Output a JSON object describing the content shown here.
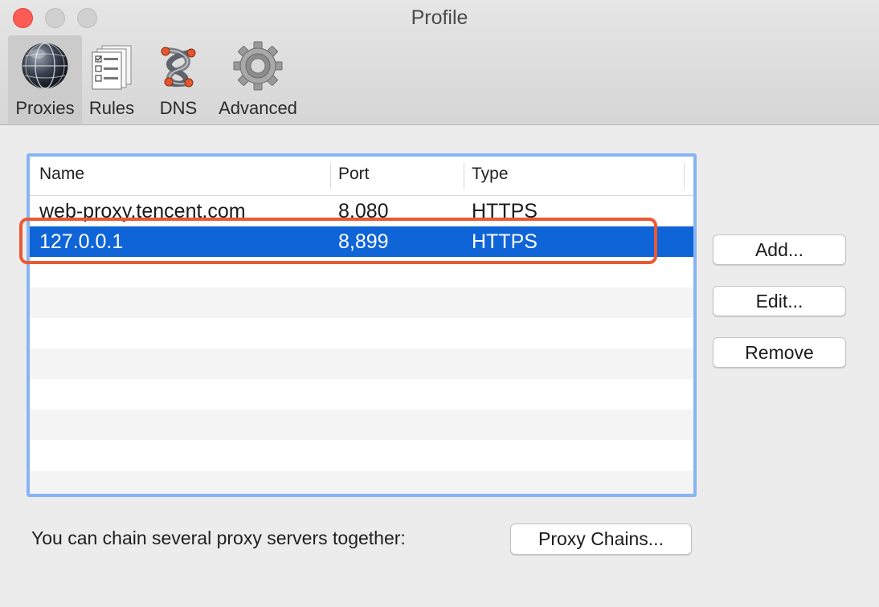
{
  "window": {
    "title": "Profile"
  },
  "toolbar": {
    "items": [
      {
        "label": "Proxies",
        "icon": "globe-icon",
        "selected": true
      },
      {
        "label": "Rules",
        "icon": "rules-list-icon"
      },
      {
        "label": "DNS",
        "icon": "dns-network-icon"
      },
      {
        "label": "Advanced",
        "icon": "gear-icon"
      }
    ]
  },
  "table": {
    "columns": [
      "Name",
      "Port",
      "Type"
    ],
    "rows": [
      {
        "name": "web-proxy.tencent.com",
        "port": "8,080",
        "type": "HTTPS"
      },
      {
        "name": "127.0.0.1",
        "port": "8,899",
        "type": "HTTPS",
        "selected": true
      }
    ]
  },
  "buttons": {
    "add": "Add...",
    "edit": "Edit...",
    "remove": "Remove"
  },
  "footer": {
    "text": "You can chain several proxy servers together:",
    "button": "Proxy Chains..."
  },
  "colors": {
    "selection": "#0f64d8",
    "focus_ring": "#88b4f4",
    "annotation_box": "#ea5a34",
    "close_button": "#fd5c54"
  }
}
